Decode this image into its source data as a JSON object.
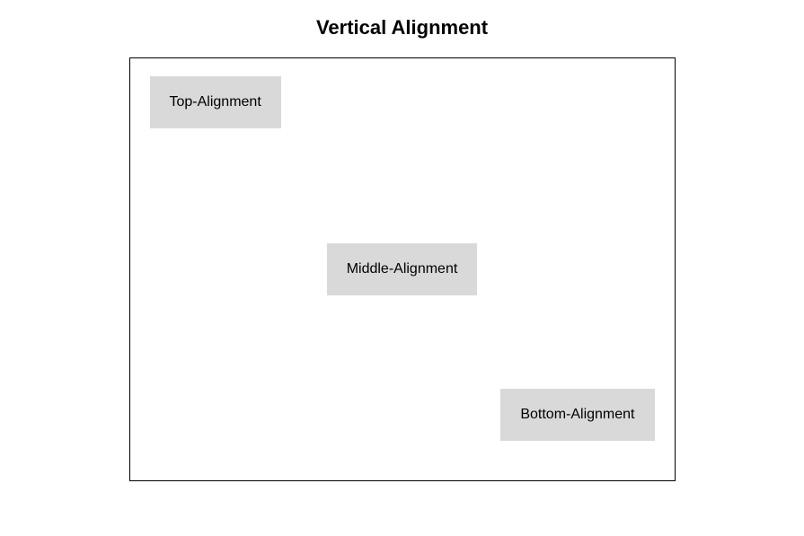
{
  "title": "Vertical Alignment",
  "boxes": {
    "top": "Top-Alignment",
    "middle": "Middle-Alignment",
    "bottom": "Bottom-Alignment"
  }
}
